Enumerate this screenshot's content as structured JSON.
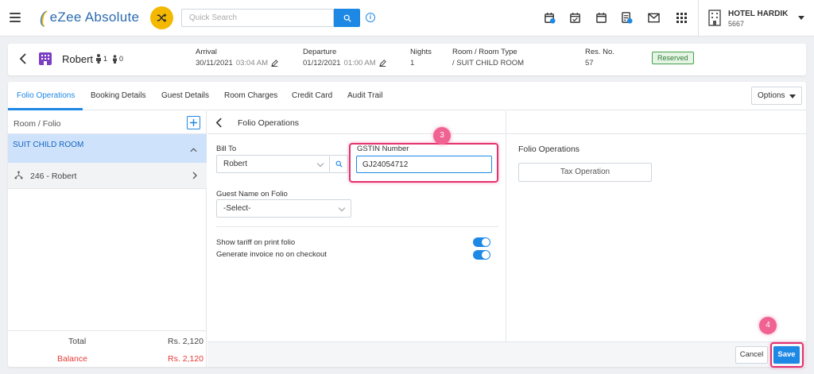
{
  "app": {
    "logo_text": "eZee Absolute",
    "search_placeholder": "Quick Search",
    "hotel_name": "HOTEL HARDIK",
    "hotel_code": "5667"
  },
  "reservation": {
    "guest_name": "Robert",
    "adults": "1",
    "children": "0",
    "arrival_label": "Arrival",
    "arrival_date": "30/11/2021",
    "arrival_time": "03:04 AM",
    "departure_label": "Departure",
    "departure_date": "01/12/2021",
    "departure_time": "01:00 AM",
    "nights_label": "Nights",
    "nights_value": "1",
    "room_label": "Room / Room Type",
    "room_value": "/ SUIT CHILD ROOM",
    "resno_label": "Res. No.",
    "resno_value": "57",
    "status": "Reserved"
  },
  "tabs": [
    "Folio Operations",
    "Booking Details",
    "Guest Details",
    "Room Charges",
    "Credit Card",
    "Audit Trail"
  ],
  "options_label": "Options",
  "left_panel": {
    "header": "Room / Folio",
    "room": "SUIT CHILD ROOM",
    "folio": "246 - Robert",
    "total_label": "Total",
    "total_value": "Rs. 2,120",
    "balance_label": "Balance",
    "balance_value": "Rs. 2,120"
  },
  "folio_form": {
    "title": "Folio Operations",
    "bill_to_label": "Bill To",
    "bill_to_value": "Robert",
    "gstin_label": "GSTIN Number",
    "gstin_value": "GJ24054712",
    "guest_name_label": "Guest Name on Folio",
    "guest_name_value": "-Select-",
    "toggle_tariff_label": "Show tariff on print folio",
    "toggle_invoice_label": "Generate invoice no on checkout"
  },
  "right_panel": {
    "title": "Folio Operations",
    "tax_button": "Tax Operation"
  },
  "footer": {
    "cancel": "Cancel",
    "save": "Save"
  },
  "annotations": {
    "step_gstin": "3",
    "step_save": "4"
  },
  "colors": {
    "accent": "#1e88e5",
    "highlight": "#e5306e",
    "status_green": "#43a047",
    "balance_red": "#e53935"
  }
}
